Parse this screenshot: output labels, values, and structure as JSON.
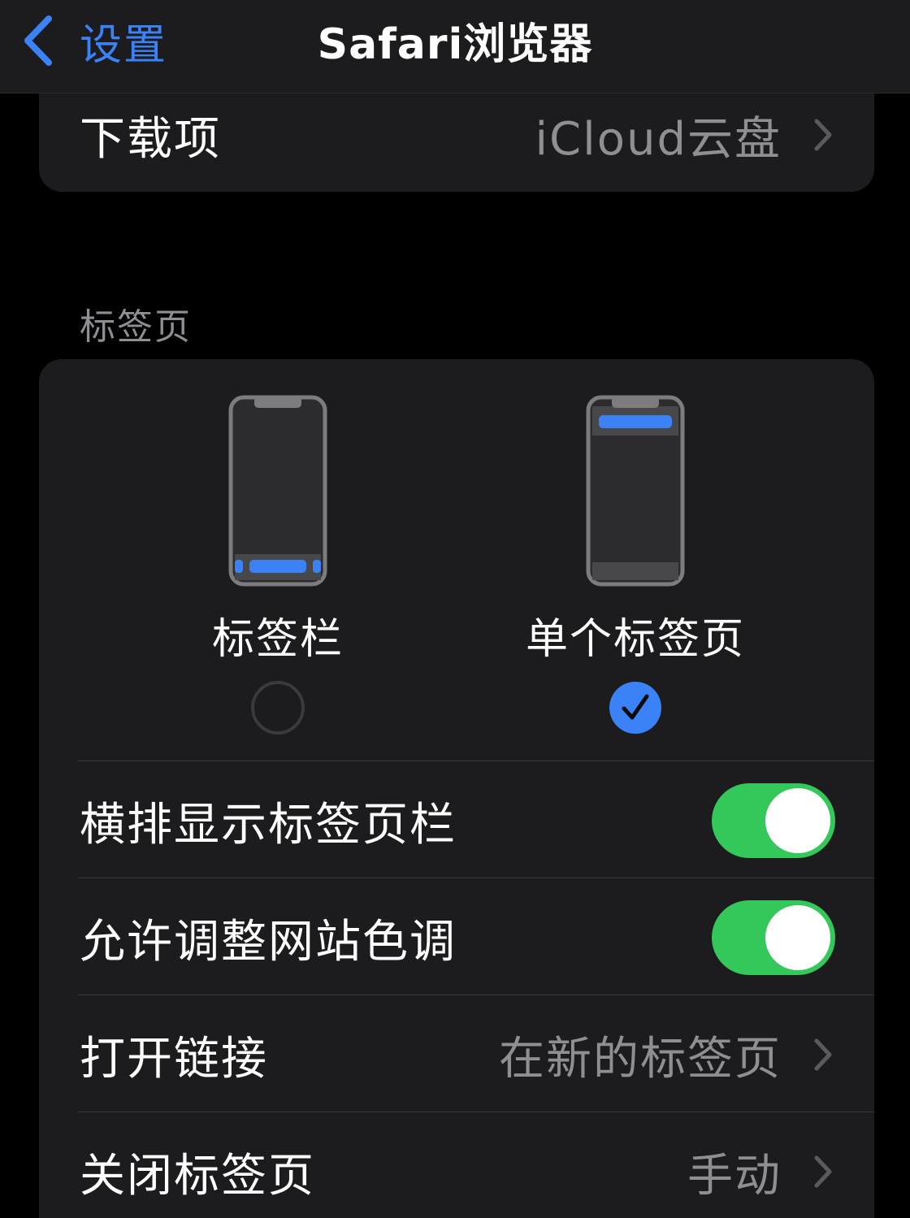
{
  "nav": {
    "back_label": "设置",
    "title": "Safari浏览器"
  },
  "downloads": {
    "label": "下载项",
    "value": "iCloud云盘"
  },
  "tabs_section": {
    "header": "标签页",
    "options": [
      {
        "label": "标签栏",
        "selected": false
      },
      {
        "label": "单个标签页",
        "selected": true
      }
    ],
    "rows": [
      {
        "label": "横排显示标签页栏",
        "toggle": true
      },
      {
        "label": "允许调整网站色调",
        "toggle": true
      },
      {
        "label": "打开链接",
        "value": "在新的标签页"
      },
      {
        "label": "关闭标签页",
        "value": "手动"
      }
    ]
  },
  "icons": {
    "back": "chevron-left-icon",
    "disclosure": "chevron-right-icon",
    "checkmark": "checkmark-icon"
  },
  "colors": {
    "accent": "#3b82f6",
    "toggle_on": "#34c759",
    "background": "#000000",
    "card": "#1c1c1e",
    "secondary_text": "#8e8e93"
  }
}
